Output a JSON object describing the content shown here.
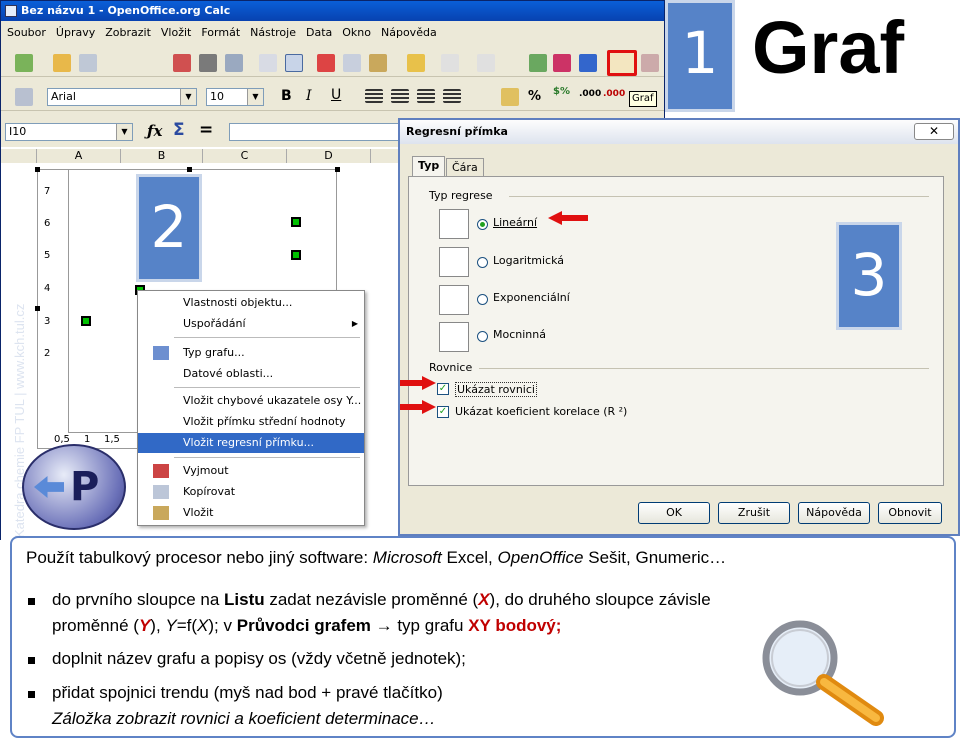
{
  "window": {
    "title": "Bez názvu 1 - OpenOffice.org Calc"
  },
  "menu": [
    "Soubor",
    "Úpravy",
    "Zobrazit",
    "Vložit",
    "Formát",
    "Nástroje",
    "Data",
    "Okno",
    "Nápověda"
  ],
  "format_bar": {
    "font": "Arial",
    "size": "10"
  },
  "formula_bar": {
    "cell": "I10"
  },
  "tooltip": "Graf",
  "columns": [
    "A",
    "B",
    "C",
    "D"
  ],
  "chart": {
    "y_ticks": [
      "7",
      "6",
      "5",
      "4",
      "3",
      "2"
    ],
    "x_ticks": [
      "0,5",
      "1",
      "1,5"
    ]
  },
  "context_menu": {
    "items": [
      "Vlastnosti objektu...",
      "Uspořádání",
      "Typ grafu...",
      "Datové oblasti...",
      "Vložit chybové ukazatele osy Y...",
      "Vložit přímku střední hodnoty",
      "Vložit regresní přímku...",
      "Vyjmout",
      "Kopírovat",
      "Vložit"
    ]
  },
  "dialog": {
    "title": "Regresní přímka",
    "close": "✕",
    "tabs": [
      "Typ",
      "Čára"
    ],
    "group_type": "Typ regrese",
    "options": [
      "Lineární",
      "Logaritmická",
      "Exponenciální",
      "Mocninná"
    ],
    "group_eq": "Rovnice",
    "checks": [
      "Ukázat rovnici",
      "Ukázat koeficient korelace (R ²)"
    ],
    "buttons": [
      "OK",
      "Zrušit",
      "Nápověda",
      "Obnovit"
    ]
  },
  "badges": {
    "one": "1",
    "two": "2",
    "three": "3"
  },
  "heading": "Graf",
  "watermark": "Katedra chemie FP TUL | www.kch.tul.cz",
  "info": {
    "intro_a": "Použít tabulkový procesor nebo jiný software: ",
    "intro_b": "Microsoft",
    "intro_c": " Excel, ",
    "intro_d": "OpenOffice",
    "intro_e": " Sešit, Gnumeric…",
    "b1_a": "do prvního sloupce na ",
    "b1_b": "Listu",
    "b1_c": " zadat nezávisle proměnné (",
    "b1_d": "X",
    "b1_e": "), do druhého sloupce závisle",
    "b1_f": "proměnné (",
    "b1_g": "Y",
    "b1_h": "), ",
    "b1_i": "Y",
    "b1_j": "=f(",
    "b1_k": "X",
    "b1_l": "); v ",
    "b1_m": "Průvodci grafem",
    "b1_n": " → typ grafu ",
    "b1_o": "XY bodový;",
    "b2": "doplnit název grafu a popisy os (vždy včetně jednotek);",
    "b3": "přidat spojnici trendu (myš nad bod + pravé tlačítko)",
    "b3_cont": "Záložka zobrazit rovnici a koeficient determinace…"
  },
  "colors": {
    "accent": "#5683c8",
    "highlight_red": "#e01010",
    "menu_select": "#3169c6"
  }
}
